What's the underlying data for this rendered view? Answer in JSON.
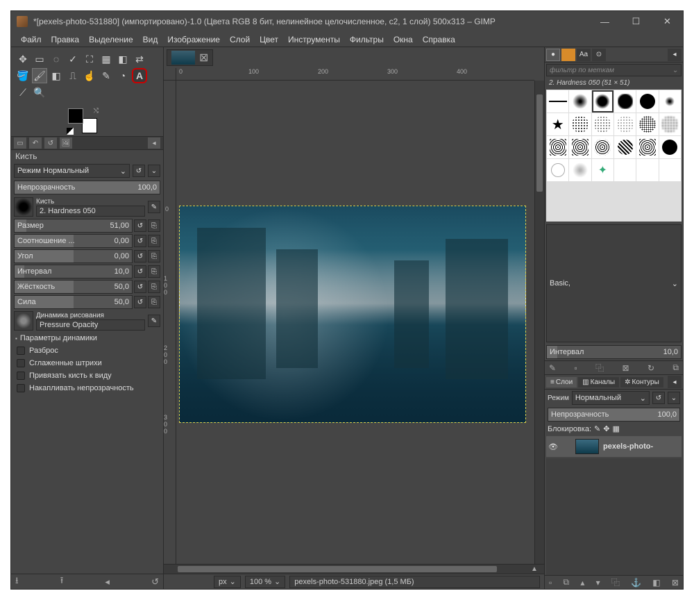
{
  "window": {
    "title": "*[pexels-photo-531880] (импортировано)-1.0 (Цвета RGB 8 бит, нелинейное целочисленное, c2, 1 слой) 500x313 – GIMP"
  },
  "menu": [
    "Файл",
    "Правка",
    "Выделение",
    "Вид",
    "Изображение",
    "Слой",
    "Цвет",
    "Инструменты",
    "Фильтры",
    "Окна",
    "Справка"
  ],
  "tool_options": {
    "title": "Кисть",
    "mode_label": "Режим",
    "mode_value": "Нормальный",
    "opacity_label": "Непрозрачность",
    "opacity_value": "100,0",
    "brush_label": "Кисть",
    "brush_name": "2. Hardness 050",
    "size_label": "Размер",
    "size_value": "51,00",
    "ratio_label": "Соотношение ...",
    "ratio_value": "0,00",
    "angle_label": "Угол",
    "angle_value": "0,00",
    "spacing_label": "Интервал",
    "spacing_value": "10,0",
    "hardness_label": "Жёсткость",
    "hardness_value": "50,0",
    "force_label": "Сила",
    "force_value": "50,0",
    "dyn_label": "Динамика рисования",
    "dyn_value": "Pressure Opacity",
    "dyn_params": "Параметры динамики",
    "chk_scatter": "Разброс",
    "chk_smooth": "Сглаженные штрихи",
    "chk_lockview": "Привязать кисть к виду",
    "chk_accum": "Накапливать непрозрачность"
  },
  "ruler_h": [
    "0",
    "100",
    "200",
    "300",
    "400"
  ],
  "ruler_v": [
    "0",
    "100",
    "200",
    "300"
  ],
  "status": {
    "unit": "px",
    "zoom": "100 %",
    "file": "pexels-photo-531880.jpeg (1,5 МБ)"
  },
  "brushes": {
    "filter_placeholder": "фильтр по меткам",
    "current": "2. Hardness 050 (51 × 51)",
    "preset": "Basic,",
    "interval_label": "Интервал",
    "interval_value": "10,0"
  },
  "layers": {
    "tabs": [
      "Слои",
      "Каналы",
      "Контуры"
    ],
    "mode_label": "Режим",
    "mode_value": "Нормальный",
    "opacity_label": "Непрозрачность",
    "opacity_value": "100,0",
    "lock_label": "Блокировка:",
    "layer_name": "pexels-photo-"
  }
}
